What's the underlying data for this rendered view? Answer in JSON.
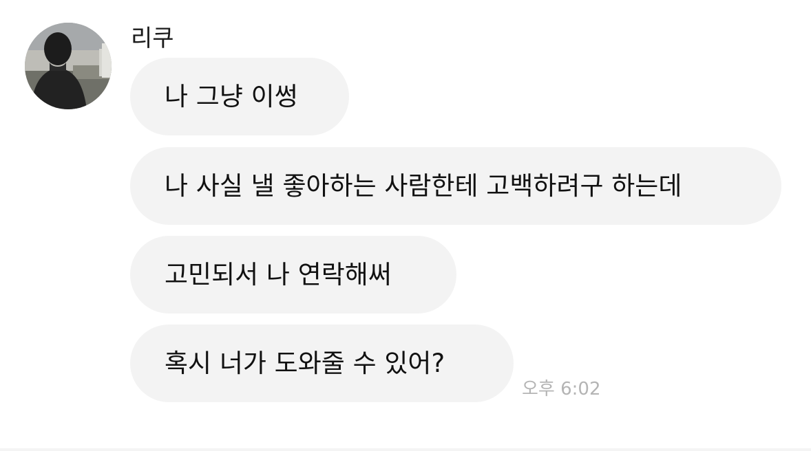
{
  "sender": {
    "name": "리쿠",
    "avatar_icon": "profile-photo"
  },
  "messages": [
    {
      "text": "나 그냥 이썽"
    },
    {
      "text": "나 사실 낼 좋아하는 사람한테 고백하려구 하는데"
    },
    {
      "text": "고민되서 나 연락해써"
    },
    {
      "text": "혹시 너가 도와줄 수 있어?"
    }
  ],
  "timestamp": "오후 6:02",
  "colors": {
    "bubble": "#f3f3f3",
    "timestamp": "#b4b4b4",
    "background": "#ffffff"
  }
}
